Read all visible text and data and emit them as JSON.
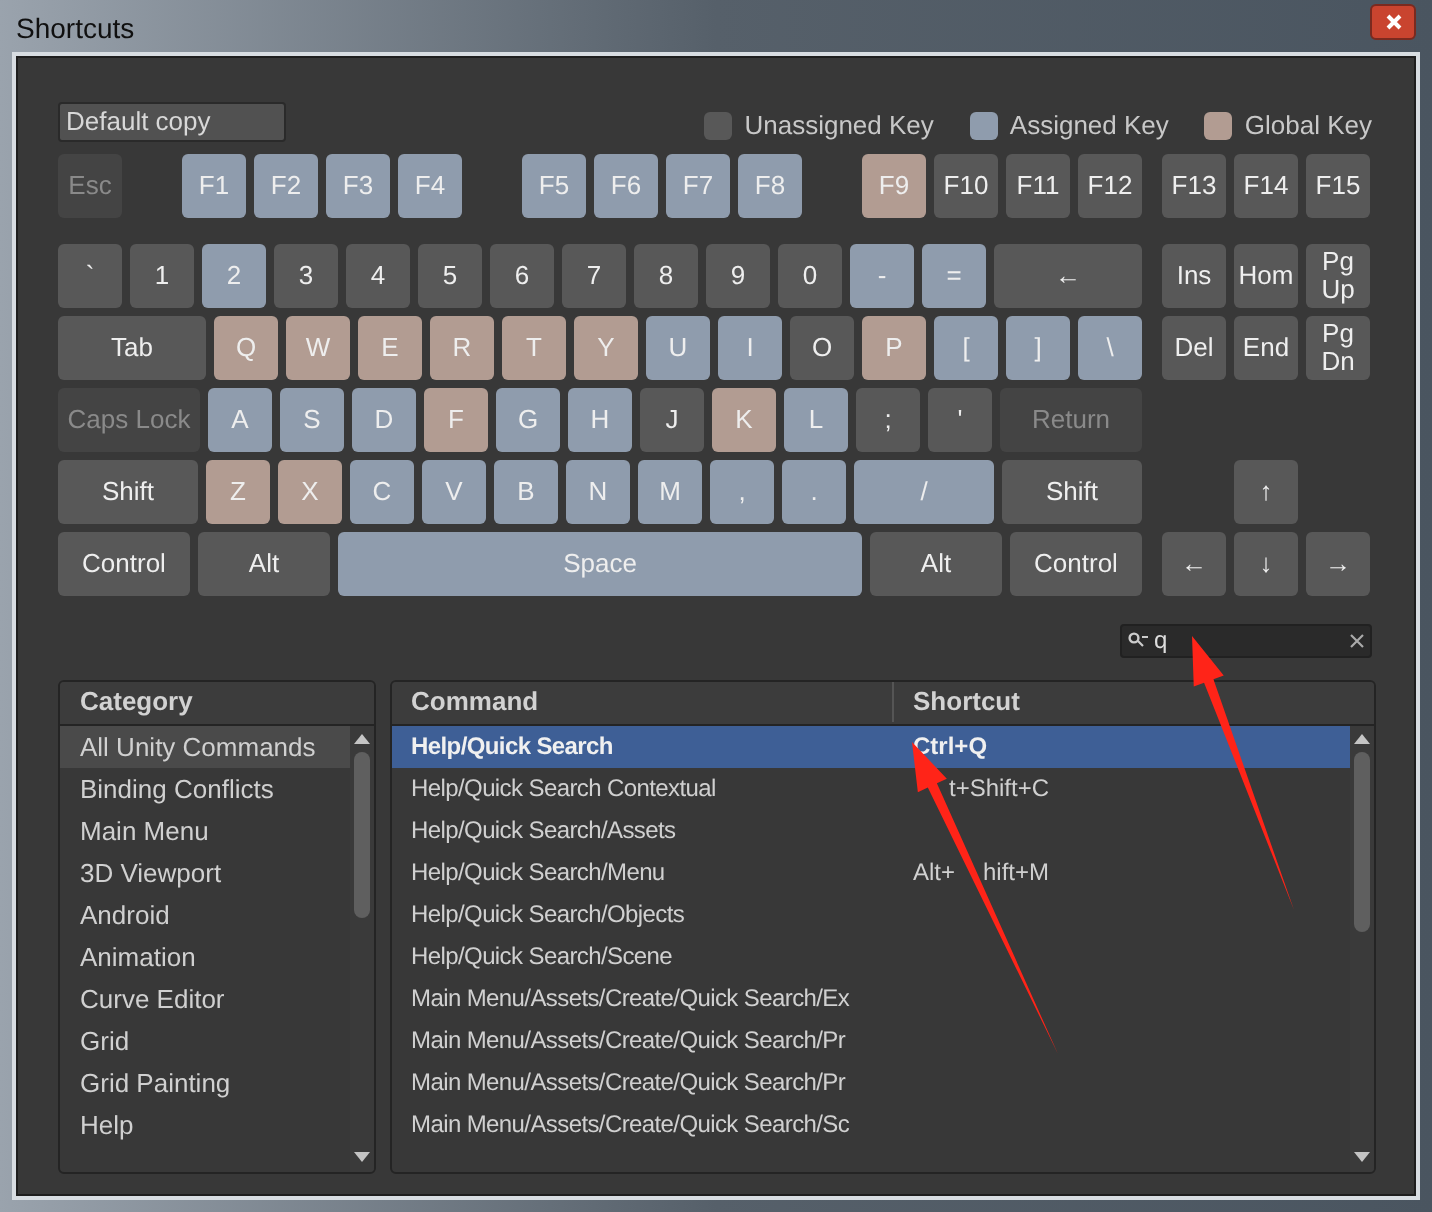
{
  "window": {
    "title": "Shortcuts"
  },
  "profile": {
    "value": "Default copy"
  },
  "legend": [
    {
      "label": "Unassigned Key",
      "color": "#585858"
    },
    {
      "label": "Assigned Key",
      "color": "#8f9cad"
    },
    {
      "label": "Global Key",
      "color": "#b29c92"
    }
  ],
  "function_keys": [
    [
      {
        "label": "Esc",
        "color": "#444444",
        "disabled": true
      }
    ],
    [
      {
        "label": "F1",
        "color": "#8f9cad",
        "disabled": false
      },
      {
        "label": "F2",
        "color": "#8f9cad",
        "disabled": false
      },
      {
        "label": "F3",
        "color": "#8f9cad",
        "disabled": false
      },
      {
        "label": "F4",
        "color": "#8f9cad",
        "disabled": false
      }
    ],
    [
      {
        "label": "F5",
        "color": "#8f9cad",
        "disabled": false
      },
      {
        "label": "F6",
        "color": "#8f9cad",
        "disabled": false
      },
      {
        "label": "F7",
        "color": "#8f9cad",
        "disabled": false
      },
      {
        "label": "F8",
        "color": "#8f9cad",
        "disabled": false
      }
    ],
    [
      {
        "label": "F9",
        "color": "#b29c92",
        "disabled": false
      },
      {
        "label": "F10",
        "color": "#585858",
        "disabled": false
      },
      {
        "label": "F11",
        "color": "#585858",
        "disabled": false
      },
      {
        "label": "F12",
        "color": "#585858",
        "disabled": false
      }
    ],
    [
      {
        "label": "F13",
        "color": "#585858",
        "disabled": false
      },
      {
        "label": "F14",
        "color": "#585858",
        "disabled": false
      },
      {
        "label": "F15",
        "color": "#585858",
        "disabled": false
      }
    ]
  ],
  "main_keys": [
    [
      {
        "label": "`",
        "kind": "standard",
        "color": "#585858",
        "disabled": false
      },
      {
        "label": "1",
        "kind": "standard",
        "color": "#585858",
        "disabled": false
      },
      {
        "label": "2",
        "kind": "standard",
        "color": "#8f9cad",
        "disabled": false
      },
      {
        "label": "3",
        "kind": "standard",
        "color": "#585858",
        "disabled": false
      },
      {
        "label": "4",
        "kind": "standard",
        "color": "#585858",
        "disabled": false
      },
      {
        "label": "5",
        "kind": "standard",
        "color": "#585858",
        "disabled": false
      },
      {
        "label": "6",
        "kind": "standard",
        "color": "#585858",
        "disabled": false
      },
      {
        "label": "7",
        "kind": "standard",
        "color": "#585858",
        "disabled": false
      },
      {
        "label": "8",
        "kind": "standard",
        "color": "#585858",
        "disabled": false
      },
      {
        "label": "9",
        "kind": "standard",
        "color": "#585858",
        "disabled": false
      },
      {
        "label": "0",
        "kind": "standard",
        "color": "#585858",
        "disabled": false
      },
      {
        "label": "-",
        "kind": "standard",
        "color": "#8f9cad",
        "disabled": false
      },
      {
        "label": "=",
        "kind": "standard",
        "color": "#8f9cad",
        "disabled": false
      },
      {
        "label": "←",
        "kind": "backspace",
        "color": "#585858",
        "disabled": false
      }
    ],
    [
      {
        "label": "Tab",
        "kind": "tab",
        "color": "#585858",
        "disabled": false
      },
      {
        "label": "Q",
        "kind": "standard",
        "color": "#b29c92",
        "disabled": false
      },
      {
        "label": "W",
        "kind": "standard",
        "color": "#b29c92",
        "disabled": false
      },
      {
        "label": "E",
        "kind": "standard",
        "color": "#b29c92",
        "disabled": false
      },
      {
        "label": "R",
        "kind": "standard",
        "color": "#b29c92",
        "disabled": false
      },
      {
        "label": "T",
        "kind": "standard",
        "color": "#b29c92",
        "disabled": false
      },
      {
        "label": "Y",
        "kind": "standard",
        "color": "#b29c92",
        "disabled": false
      },
      {
        "label": "U",
        "kind": "standard",
        "color": "#8f9cad",
        "disabled": false
      },
      {
        "label": "I",
        "kind": "standard",
        "color": "#8f9cad",
        "disabled": false
      },
      {
        "label": "O",
        "kind": "standard",
        "color": "#585858",
        "disabled": false
      },
      {
        "label": "P",
        "kind": "standard",
        "color": "#b29c92",
        "disabled": false
      },
      {
        "label": "[",
        "kind": "standard",
        "color": "#8f9cad",
        "disabled": false
      },
      {
        "label": "]",
        "kind": "standard",
        "color": "#8f9cad",
        "disabled": false
      },
      {
        "label": "\\",
        "kind": "standard",
        "color": "#8f9cad",
        "disabled": false
      }
    ],
    [
      {
        "label": "Caps Lock",
        "kind": "capslock",
        "color": "#444444",
        "disabled": true
      },
      {
        "label": "A",
        "kind": "standard",
        "color": "#8f9cad",
        "disabled": false
      },
      {
        "label": "S",
        "kind": "standard",
        "color": "#8f9cad",
        "disabled": false
      },
      {
        "label": "D",
        "kind": "standard",
        "color": "#8f9cad",
        "disabled": false
      },
      {
        "label": "F",
        "kind": "standard",
        "color": "#b29c92",
        "disabled": false
      },
      {
        "label": "G",
        "kind": "standard",
        "color": "#8f9cad",
        "disabled": false
      },
      {
        "label": "H",
        "kind": "standard",
        "color": "#8f9cad",
        "disabled": false
      },
      {
        "label": "J",
        "kind": "standard",
        "color": "#585858",
        "disabled": false
      },
      {
        "label": "K",
        "kind": "standard",
        "color": "#b29c92",
        "disabled": false
      },
      {
        "label": "L",
        "kind": "standard",
        "color": "#8f9cad",
        "disabled": false
      },
      {
        "label": ";",
        "kind": "standard",
        "color": "#585858",
        "disabled": false
      },
      {
        "label": "'",
        "kind": "standard",
        "color": "#585858",
        "disabled": false
      },
      {
        "label": "Return",
        "kind": "return",
        "color": "#444444",
        "disabled": true
      }
    ],
    [
      {
        "label": "Shift",
        "kind": "shift",
        "color": "#585858",
        "disabled": false
      },
      {
        "label": "Z",
        "kind": "standard",
        "color": "#b29c92",
        "disabled": false
      },
      {
        "label": "X",
        "kind": "standard",
        "color": "#b29c92",
        "disabled": false
      },
      {
        "label": "C",
        "kind": "standard",
        "color": "#8f9cad",
        "disabled": false
      },
      {
        "label": "V",
        "kind": "standard",
        "color": "#8f9cad",
        "disabled": false
      },
      {
        "label": "B",
        "kind": "standard",
        "color": "#8f9cad",
        "disabled": false
      },
      {
        "label": "N",
        "kind": "standard",
        "color": "#8f9cad",
        "disabled": false
      },
      {
        "label": "M",
        "kind": "standard",
        "color": "#8f9cad",
        "disabled": false
      },
      {
        "label": ",",
        "kind": "standard",
        "color": "#8f9cad",
        "disabled": false
      },
      {
        "label": ".",
        "kind": "standard",
        "color": "#8f9cad",
        "disabled": false
      },
      {
        "label": "/",
        "kind": "shift",
        "color": "#8f9cad",
        "disabled": false
      },
      {
        "label": "Shift",
        "kind": "shift",
        "color": "#585858",
        "disabled": false
      }
    ],
    [
      {
        "label": "Control",
        "kind": "modifier",
        "color": "#585858",
        "disabled": false
      },
      {
        "label": "Alt",
        "kind": "modifier",
        "color": "#585858",
        "disabled": false
      },
      {
        "label": "Space",
        "kind": "space",
        "color": "#8f9cad",
        "disabled": false
      },
      {
        "label": "Alt",
        "kind": "modifier",
        "color": "#585858",
        "disabled": false
      },
      {
        "label": "Control",
        "kind": "modifier",
        "color": "#585858",
        "disabled": false
      }
    ]
  ],
  "navigation_keys": [
    [
      {
        "label": "Ins",
        "color": "#585858"
      },
      {
        "label": "Hom",
        "color": "#585858"
      },
      {
        "label": "Pg Up",
        "color": "#585858"
      }
    ],
    [
      {
        "label": "Del",
        "color": "#585858"
      },
      {
        "label": "End",
        "color": "#585858"
      },
      {
        "label": "Pg Dn",
        "color": "#585858"
      }
    ]
  ],
  "arrow_keys": [
    [
      {
        "label": "↑",
        "color": "#585858"
      }
    ],
    [
      {
        "label": "←",
        "color": "#585858"
      },
      {
        "label": "↓",
        "color": "#585858"
      },
      {
        "label": "→",
        "color": "#585858"
      }
    ]
  ],
  "search": {
    "value": "q"
  },
  "category": {
    "header": "Category",
    "items": [
      {
        "label": "All Unity Commands",
        "selected": true
      },
      {
        "label": "Binding Conflicts",
        "selected": false
      },
      {
        "label": "Main Menu",
        "selected": false
      },
      {
        "label": "3D Viewport",
        "selected": false
      },
      {
        "label": "Android",
        "selected": false
      },
      {
        "label": "Animation",
        "selected": false
      },
      {
        "label": "Curve Editor",
        "selected": false
      },
      {
        "label": "Grid",
        "selected": false
      },
      {
        "label": "Grid Painting",
        "selected": false
      },
      {
        "label": "Help",
        "selected": false
      }
    ]
  },
  "commands": {
    "columns": [
      "Command",
      "Shortcut"
    ],
    "rows": [
      {
        "command": "Help/Quick Search",
        "shortcut": [
          "Ctrl+Q"
        ],
        "selected": true
      },
      {
        "command": "Help/Quick Search Contextual",
        "shortcut": [
          "t+Shift+C"
        ],
        "selected": false
      },
      {
        "command": "Help/Quick Search/Assets",
        "selected": false
      },
      {
        "command": "Help/Quick Search/Menu",
        "shortcut": [
          "Alt+",
          "hift+M"
        ],
        "selected": false
      },
      {
        "command": "Help/Quick Search/Objects",
        "selected": false
      },
      {
        "command": "Help/Quick Search/Scene",
        "selected": false
      },
      {
        "command": "Main Menu/Assets/Create/Quick Search/Ex",
        "selected": false
      },
      {
        "command": "Main Menu/Assets/Create/Quick Search/Pr",
        "selected": false
      },
      {
        "command": "Main Menu/Assets/Create/Quick Search/Pr",
        "selected": false
      },
      {
        "command": "Main Menu/Assets/Create/Quick Search/Sc",
        "selected": false
      }
    ]
  }
}
